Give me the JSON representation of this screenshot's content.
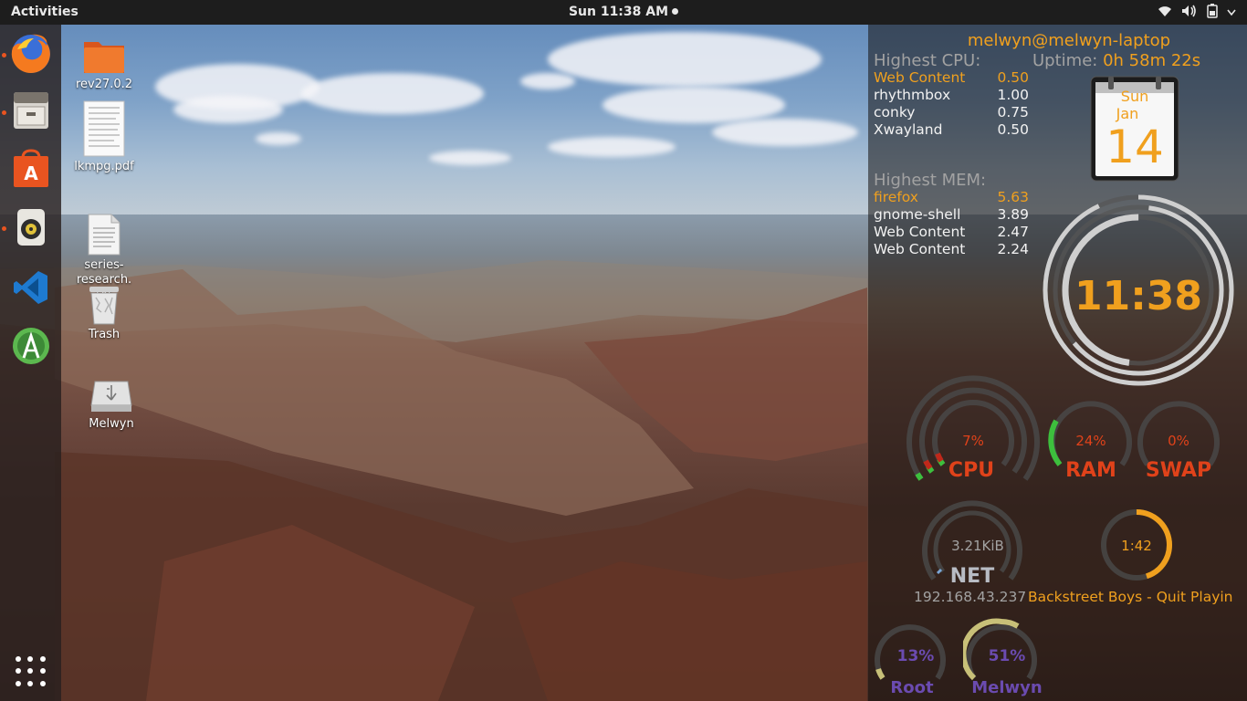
{
  "topbar": {
    "activities": "Activities",
    "clock": "Sun 11:38 AM",
    "tray_icons": [
      "wifi-icon",
      "volume-icon",
      "battery-icon",
      "system-menu-icon"
    ]
  },
  "dock": {
    "items": [
      {
        "name": "firefox",
        "running": true
      },
      {
        "name": "files",
        "running": true
      },
      {
        "name": "software-center",
        "running": false
      },
      {
        "name": "rhythmbox",
        "running": true
      },
      {
        "name": "vscode",
        "running": false
      },
      {
        "name": "android-studio",
        "running": false
      }
    ],
    "show_apps": "show-applications-icon"
  },
  "desktop": {
    "icons": [
      {
        "label": "rev27.0.2",
        "type": "folder"
      },
      {
        "label": "lkmpg.pdf",
        "type": "pdf"
      },
      {
        "label": "series-\nresearch.\ntxt",
        "type": "text"
      },
      {
        "label": "Trash",
        "type": "trash"
      },
      {
        "label": "Melwyn",
        "type": "usb-drive"
      }
    ]
  },
  "conky": {
    "user_host": "melwyn@melwyn-laptop",
    "uptime_label": "Uptime:",
    "uptime_value": "0h 58m 22s",
    "cpu": {
      "header": "Highest CPU:",
      "rows": [
        {
          "name": "Web Content",
          "value": "0.50"
        },
        {
          "name": "rhythmbox",
          "value": "1.00"
        },
        {
          "name": "conky",
          "value": "0.75"
        },
        {
          "name": "Xwayland",
          "value": "0.50"
        }
      ]
    },
    "mem": {
      "header": "Highest MEM:",
      "rows": [
        {
          "name": "firefox",
          "value": "5.63"
        },
        {
          "name": "gnome-shell",
          "value": "3.89"
        },
        {
          "name": "Web Content",
          "value": "2.47"
        },
        {
          "name": "Web Content",
          "value": "2.24"
        }
      ]
    },
    "calendar": {
      "day": "Sun",
      "month": "Jan",
      "date": "14"
    },
    "time": "11:38",
    "gauges": {
      "cpu": {
        "label": "CPU",
        "value": "7%",
        "fraction": 0.07
      },
      "ram": {
        "label": "RAM",
        "value": "24%",
        "fraction": 0.24
      },
      "swap": {
        "label": "SWAP",
        "value": "0%",
        "fraction": 0.0
      },
      "net": {
        "label": "NET",
        "value": "3.21KiB",
        "ip": "192.168.43.237"
      },
      "music": {
        "time": "1:42",
        "title": "Backstreet Boys - Quit Playin",
        "fraction": 0.45
      },
      "root": {
        "label": "Root",
        "value": "13%",
        "fraction": 0.13
      },
      "home": {
        "label": "Melwyn",
        "value": "51%",
        "fraction": 0.51
      }
    }
  },
  "colors": {
    "orange": "#f0a01e",
    "red": "#e0421a",
    "grey": "#a2a2a2",
    "purple": "#6b4bb0",
    "ubuntu_orange": "#e95420"
  }
}
